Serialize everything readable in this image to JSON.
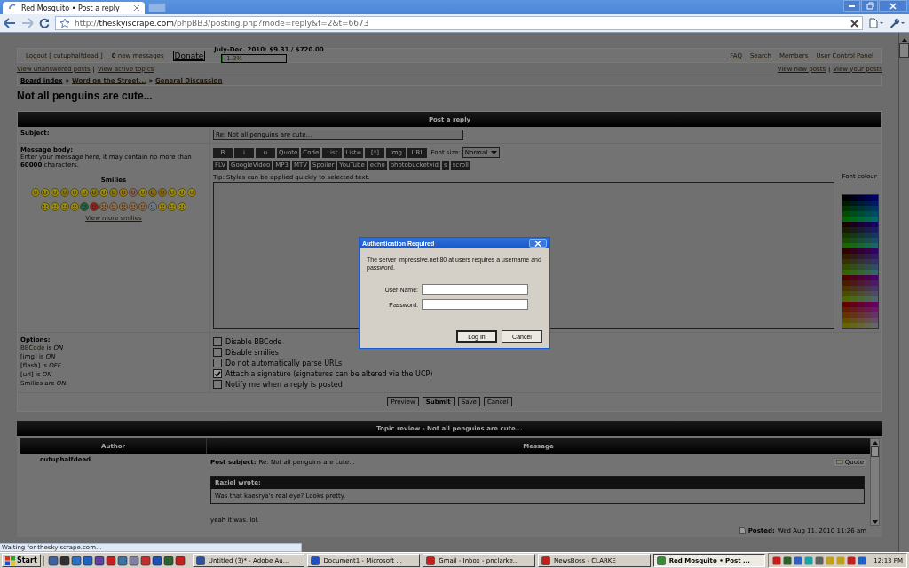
{
  "browser": {
    "tabs": [
      {
        "title": "Red Mosquito • Post a reply",
        "selected": true
      }
    ],
    "url_host": "theskyiscrape.com",
    "url_prefix": "http://",
    "url_path": "/phpBB3/posting.php?mode=reply&f=2&t=6673"
  },
  "header": {
    "logout": "Logout [ cutuphalfdead ]",
    "messages": "**0** new messages",
    "donate": "Donate",
    "donation": "July-Dec. 2010: $9.31 / $720.00",
    "donation_progress": {
      "level": 0.013,
      "reading": "1.3%"
    },
    "nav": [
      "FAQ",
      "Search",
      "Members",
      "User Control Panel"
    ]
  },
  "links_left": [
    {
      "label": "View unanswered posts"
    },
    {
      "separator": "|",
      "label": "View active topics"
    }
  ],
  "links_right": [
    {
      "label": "View new posts"
    },
    {
      "separator": "|",
      "label": "View your posts"
    }
  ],
  "breadcrumb": [
    {
      "label": "Board index"
    },
    {
      "separator": "»",
      "label": "Word on the Street..."
    },
    {
      "separator": "»",
      "label": "General Discussion"
    }
  ],
  "topic_title": "Not all penguins are cute...",
  "post_form": {
    "header": "Post a reply",
    "subject_label": "Subject:",
    "subject_value": "Re: Not all penguins are cute...",
    "message_label": "Message body:",
    "message_hint": "Enter your message here, it may contain no more than **60000** characters.",
    "smilies_title": "Smilies",
    "more_smilies": "View more smilies",
    "bbcode_row1": [
      "B",
      "i",
      "u",
      "Quote",
      "Code",
      "List",
      "List=",
      "[*]",
      "Img",
      "URL"
    ],
    "font_size_label": "Font size:",
    "font_size_value": "Normal",
    "bbcode_row2": [
      "FLV",
      "GoogleVideo",
      "MP3",
      "MTV",
      "Spoiler",
      "YouTube",
      "echo",
      "photobucketvid",
      "s",
      "scroll"
    ],
    "tip": "Tip: Styles can be applied quickly to selected text.",
    "font_colour_label": "Font colour",
    "options_label": "Options:",
    "options_status": [
      {
        "link": "BBCode",
        "text": "is *ON*"
      },
      {
        "text": "[img] is *ON*"
      },
      {
        "text": "[flash] is *OFF*"
      },
      {
        "text": "[url] is *ON*"
      },
      {
        "text": "Smilies are *ON*"
      }
    ],
    "checkboxes": [
      {
        "label": "Disable BBCode",
        "checked": false
      },
      {
        "label": "Disable smilies",
        "checked": false
      },
      {
        "label": "Do not automatically parse URLs",
        "checked": false
      },
      {
        "label": "Attach a signature (signatures can be altered via the UCP)",
        "checked": true
      },
      {
        "label": "Notify me when a reply is posted",
        "checked": false
      }
    ],
    "buttons": [
      {
        "label": "Preview",
        "primary": false
      },
      {
        "label": "Submit",
        "primary": true
      },
      {
        "label": "Save",
        "primary": false
      },
      {
        "label": "Cancel",
        "primary": false
      }
    ]
  },
  "topic_review": {
    "header": "Topic review - Not all penguins are cute...",
    "columns": [
      "Author",
      "Message"
    ],
    "post": {
      "author": "cutuphalfdead",
      "subject_label": "Post subject:",
      "subject": "Re: Not all penguins are cute...",
      "quote_button": "Quote",
      "quote_author": "Raziel wrote:",
      "quote_text": "Was that kaesrya's real eye? Looks pretty.",
      "body": "yeah it was. lol.",
      "posted_label": "Posted:",
      "posted": "Wed Aug 11, 2010 11:26 am"
    }
  },
  "dialog": {
    "title": "Authentication Required",
    "message": "The server impressive.net:80 at users requires a username and password.",
    "fields": [
      {
        "label": "User Name:"
      },
      {
        "label": "Password:"
      }
    ],
    "buttons": [
      "Log In",
      "Cancel"
    ]
  },
  "status": "Waiting for theskyiscrape.com...",
  "taskbar": {
    "start": "Start",
    "tasks": [
      {
        "title": "Untitled (3)* - Adobe Au...",
        "selected": false
      },
      {
        "title": "Document1 - Microsoft ...",
        "selected": false
      },
      {
        "title": "Gmail - Inbox - pnclarke...",
        "selected": false
      },
      {
        "title": "NewsBoss - CLARKE",
        "selected": false
      },
      {
        "title": "Red Mosquito • Post ...",
        "selected": true
      }
    ],
    "clock": "12:13 PM"
  }
}
